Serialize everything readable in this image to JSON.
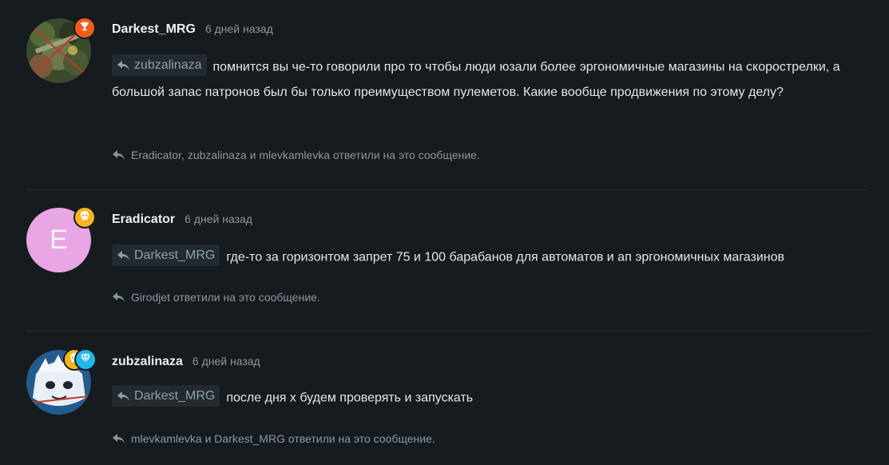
{
  "posts": [
    {
      "author": "Darkest_MRG",
      "time": "6 дней назад",
      "mention": "zubzalinaza",
      "text": "помнится вы че-то говорили про то чтобы люди юзали более эргономичные магазины на скорострелки, а большой запас патронов был бы только преимуществом пулеметов. Какие вообще продвижения по этому делу?",
      "replies": "Eradicator, zubzalinaza и mlevkamlevka ответили на это сообщение.",
      "badge_icon": "trophy-icon",
      "badge_color": "#f25c1f"
    },
    {
      "author": "Eradicator",
      "time": "6 дней назад",
      "avatar_letter": "E",
      "avatar_color": "#e8a6e4",
      "mention": "Darkest_MRG",
      "text": "где-то за горизонтом запрет 75 и 100 барабанов для автоматов и ап эргономичных магазинов",
      "replies": "Girodjet ответили на это сообщение.",
      "badge_icon": "skull-icon",
      "badge_color": "#f5b51b"
    },
    {
      "author": "zubzalinaza",
      "time": "6 дней назад",
      "mention": "Darkest_MRG",
      "text": "после дня х будем проверять и запускать",
      "replies": "mlevkamlevka и Darkest_MRG ответили на это сообщение.",
      "badge_icons": [
        "skull-icon",
        "diamond-icon"
      ],
      "badge_colors": [
        "#f5b51b",
        "#1fb8e6"
      ]
    }
  ]
}
